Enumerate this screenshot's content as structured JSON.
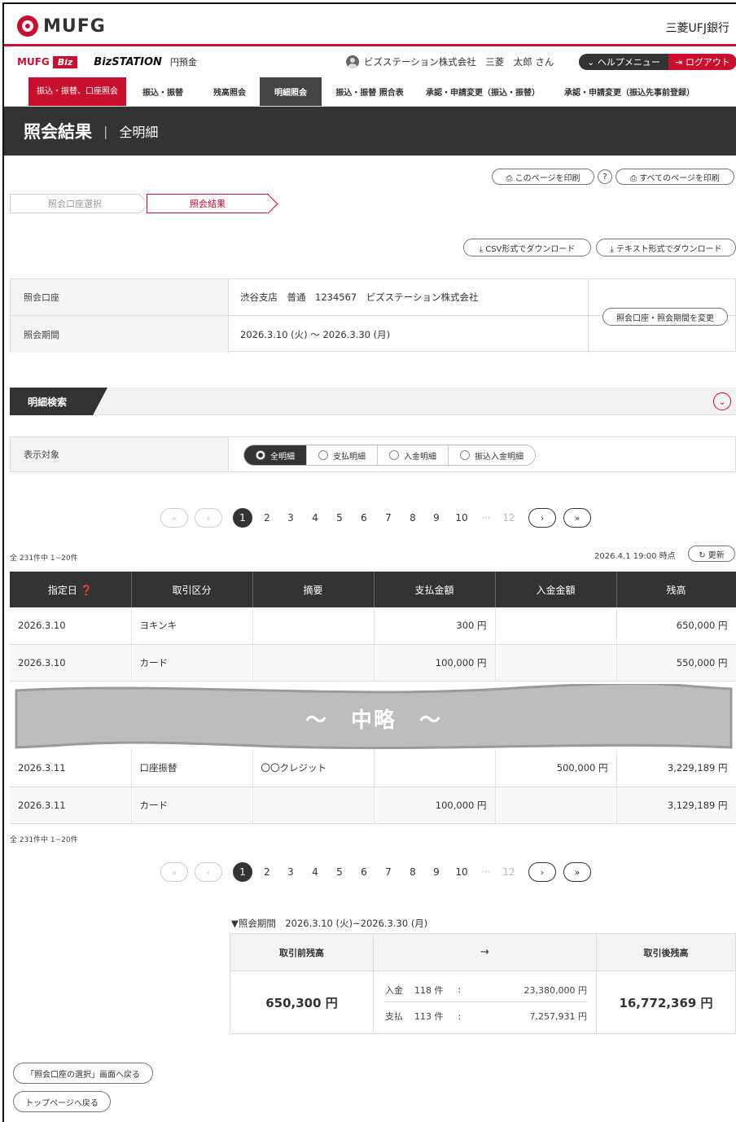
{
  "brand": {
    "logo_text": "MUFG",
    "bank_name": "三菱UFJ銀行"
  },
  "service": {
    "mufg": "MUFG",
    "biz": "Biz",
    "station": "BizSTATION",
    "product": "円預金",
    "user": "ビズステーション株式会社　三菱　太郎 さん",
    "help": "⌄ ヘルプメニュー",
    "logout": "⇥ ログアウト"
  },
  "nav": [
    "振込・振替、口座照会",
    "振込・振替",
    "残高照会",
    "明細照会",
    "振込・振替 照合表",
    "承認・申請変更（振込・振替）",
    "承認・申請変更（振込先事前登録）"
  ],
  "page": {
    "title": "照会結果",
    "subtitle": "全明細"
  },
  "print": {
    "this_page": "⎙ このページを印刷",
    "help": "?",
    "all_pages": "⎙ すべてのページを印刷"
  },
  "steps": {
    "step1": "照会口座選択",
    "step2": "照会結果"
  },
  "download": {
    "csv": "⤓ CSV形式でダウンロード",
    "text": "⤓ テキスト形式でダウンロード"
  },
  "account": {
    "label_account": "照会口座",
    "account": "渋谷支店　普通　1234567　ビズステーション株式会社",
    "label_period": "照会期間",
    "period": "2026.3.10 (火) ～ 2026.3.30 (月)",
    "change_button": "照会口座・照会期間を変更"
  },
  "search": {
    "section_title": "明細検索",
    "toggle": "⌄"
  },
  "filter": {
    "label": "表示対象",
    "options": [
      "全明細",
      "支払明細",
      "入金明細",
      "振込入金明細"
    ],
    "selected": "全明細"
  },
  "pagination": {
    "first": "«",
    "prev": "‹",
    "pages": [
      "1",
      "2",
      "3",
      "4",
      "5",
      "6",
      "7",
      "8",
      "9",
      "10"
    ],
    "ellipsis": "···",
    "last_page": "12",
    "next": "›",
    "last": "»",
    "current": "1"
  },
  "count_text": "全 231件中 1~20件",
  "timestamp": "2026.4.1 19:00 時点",
  "refresh": "↻ 更新",
  "table": {
    "headers": [
      "指定日 ❓",
      "取引区分",
      "摘要",
      "支払金額",
      "入金金額",
      "残高"
    ],
    "rows_top": [
      [
        "2026.3.10",
        "ヨキンキ",
        "",
        "300 円",
        "",
        "650,000 円"
      ],
      [
        "2026.3.10",
        "カード",
        "",
        "100,000 円",
        "",
        "550,000 円"
      ]
    ],
    "rows_bottom": [
      [
        "2026.3.11",
        "口座振替",
        "〇〇クレジット",
        "",
        "500,000 円",
        "3,229,189 円"
      ],
      [
        "2026.3.11",
        "カード",
        "",
        "100,000 円",
        "",
        "3,129,189 円"
      ]
    ]
  },
  "omitted": "～　中略　～",
  "summary": {
    "label": "▼照会期間　2026.3.10 (火)~2026.3.30 (月)",
    "before_label": "取引前残高",
    "arrow": "→",
    "after_label": "取引後残高",
    "before": "650,300 円",
    "after": "16,772,369 円",
    "deposit_label": "入金",
    "deposit_count": "118 件",
    "deposit_amount": "23,380,000 円",
    "payment_label": "支払",
    "payment_count": "113 件",
    "payment_amount": "7,257,931 円",
    "colon": ":"
  },
  "back": {
    "account_select": "「照会口座の選択」画面へ戻る",
    "top": "トップページへ戻る"
  },
  "colors": {
    "brand_red": "#c8102e",
    "dark": "#333333"
  }
}
